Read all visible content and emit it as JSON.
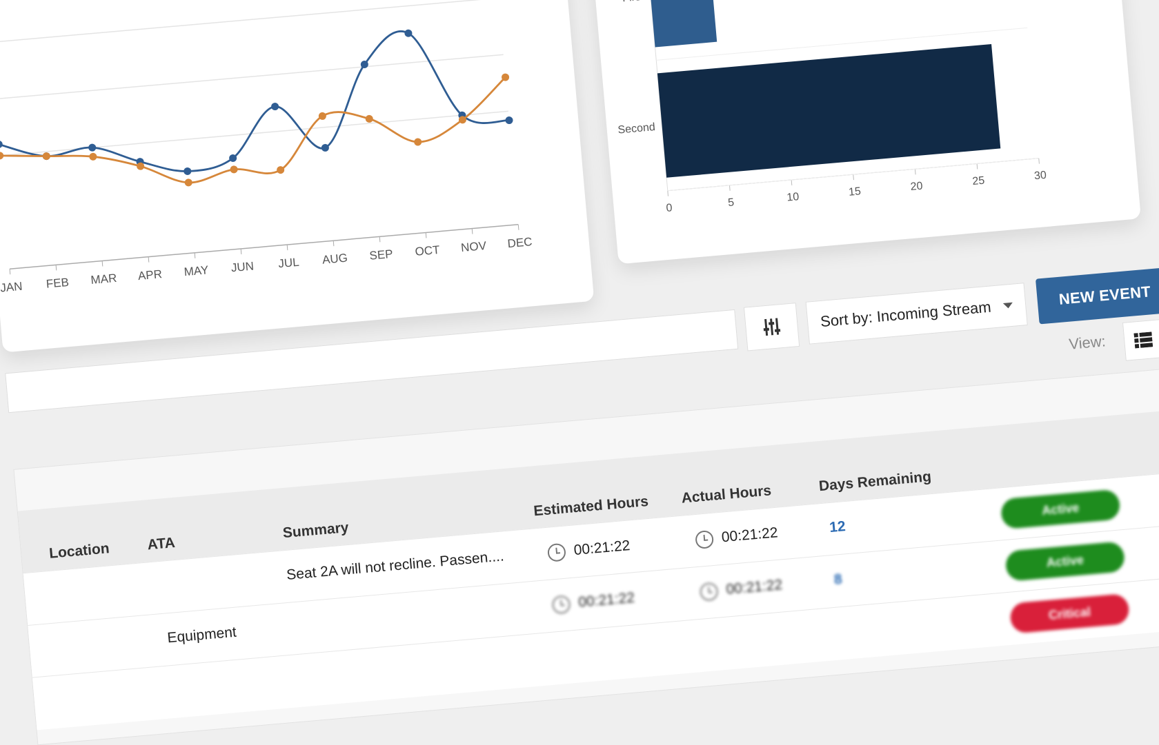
{
  "line_chart": {
    "type": "line",
    "x": [
      "JAN",
      "FEB",
      "MAR",
      "APR",
      "MAY",
      "JUN",
      "JUL",
      "AUG",
      "SEP",
      "OCT",
      "NOV",
      "DEC"
    ],
    "series": [
      {
        "values": [
          55,
          48,
          50,
          42,
          36,
          40,
          61,
          41,
          76,
          88,
          50,
          46
        ],
        "color": "#2f5d93"
      },
      {
        "values": [
          50,
          48,
          46,
          40,
          31,
          35,
          33,
          55,
          52,
          40,
          48,
          65
        ],
        "color": "#d6873a"
      }
    ],
    "ylim": [
      0,
      100
    ],
    "grid": true
  },
  "bar_chart": {
    "type": "bar",
    "orientation": "horizontal",
    "categories": [
      "First",
      "Second"
    ],
    "values": [
      5,
      27
    ],
    "colors": [
      "#2f5d8e",
      "#112a46"
    ],
    "xlim": [
      0,
      30
    ],
    "xticks": [
      0,
      5,
      10,
      15,
      20,
      25,
      30
    ]
  },
  "toolbar": {
    "sort_label": "Sort by: Incoming Stream",
    "new_event_label": "NEW EVENT",
    "view_label": "View:"
  },
  "table": {
    "headers": {
      "location": "Location",
      "ata": "ATA",
      "summary": "Summary",
      "estimated": "Estimated Hours",
      "actual": "Actual Hours",
      "days": "Days Remaining"
    },
    "rows": [
      {
        "location": "",
        "ata": "",
        "summary": "Seat 2A will not recline. Passen....",
        "estimated": "00:21:22",
        "actual": "00:21:22",
        "days": "12",
        "status": "Active",
        "status_color": "#1e8c1e"
      },
      {
        "location": "Equipment",
        "ata": "",
        "summary": "",
        "estimated": "00:21:22",
        "actual": "00:21:22",
        "days": "8",
        "status": "Active",
        "status_color": "#1e8c1e"
      },
      {
        "location": "",
        "ata": "",
        "summary": "",
        "estimated": "",
        "actual": "",
        "days": "",
        "status": "Critical",
        "status_color": "#d9203a"
      }
    ]
  }
}
